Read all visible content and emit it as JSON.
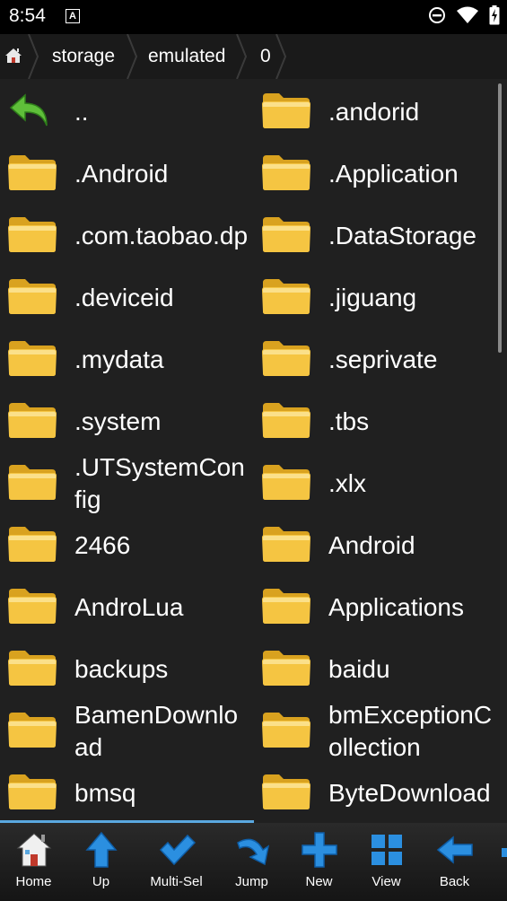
{
  "status": {
    "time": "8:54",
    "a_icon": "A"
  },
  "breadcrumb": {
    "items": [
      "storage",
      "emulated",
      "0"
    ]
  },
  "files": [
    {
      "name": "..",
      "type": "up"
    },
    {
      "name": ".andorid",
      "type": "folder"
    },
    {
      "name": ".Android",
      "type": "folder"
    },
    {
      "name": ".Application",
      "type": "folder"
    },
    {
      "name": ".com.taobao.dp",
      "type": "folder"
    },
    {
      "name": ".DataStorage",
      "type": "folder"
    },
    {
      "name": ".deviceid",
      "type": "folder"
    },
    {
      "name": ".jiguang",
      "type": "folder"
    },
    {
      "name": ".mydata",
      "type": "folder"
    },
    {
      "name": ".seprivate",
      "type": "folder"
    },
    {
      "name": ".system",
      "type": "folder"
    },
    {
      "name": ".tbs",
      "type": "folder"
    },
    {
      "name": ".UTSystemConfig",
      "type": "folder"
    },
    {
      "name": ".xlx",
      "type": "folder"
    },
    {
      "name": "2466",
      "type": "folder"
    },
    {
      "name": "Android",
      "type": "folder"
    },
    {
      "name": "AndroLua",
      "type": "folder"
    },
    {
      "name": "Applications",
      "type": "folder"
    },
    {
      "name": "backups",
      "type": "folder"
    },
    {
      "name": "baidu",
      "type": "folder"
    },
    {
      "name": "BamenDownload",
      "type": "folder"
    },
    {
      "name": "bmExceptionCollection",
      "type": "folder"
    },
    {
      "name": "bmsq",
      "type": "folder"
    },
    {
      "name": "ByteDownload",
      "type": "folder"
    }
  ],
  "toolbar": {
    "items": [
      {
        "label": "Home",
        "icon": "home-icon"
      },
      {
        "label": "Up",
        "icon": "up-arrow-icon"
      },
      {
        "label": "Multi-Sel",
        "icon": "checkmark-icon"
      },
      {
        "label": "Jump",
        "icon": "jump-arrow-icon"
      },
      {
        "label": "New",
        "icon": "plus-icon"
      },
      {
        "label": "View",
        "icon": "grid-view-icon"
      },
      {
        "label": "Back",
        "icon": "back-arrow-icon"
      }
    ]
  },
  "colors": {
    "folder": "#f5c542",
    "accent": "#2b8fe0",
    "background": "#202020"
  }
}
